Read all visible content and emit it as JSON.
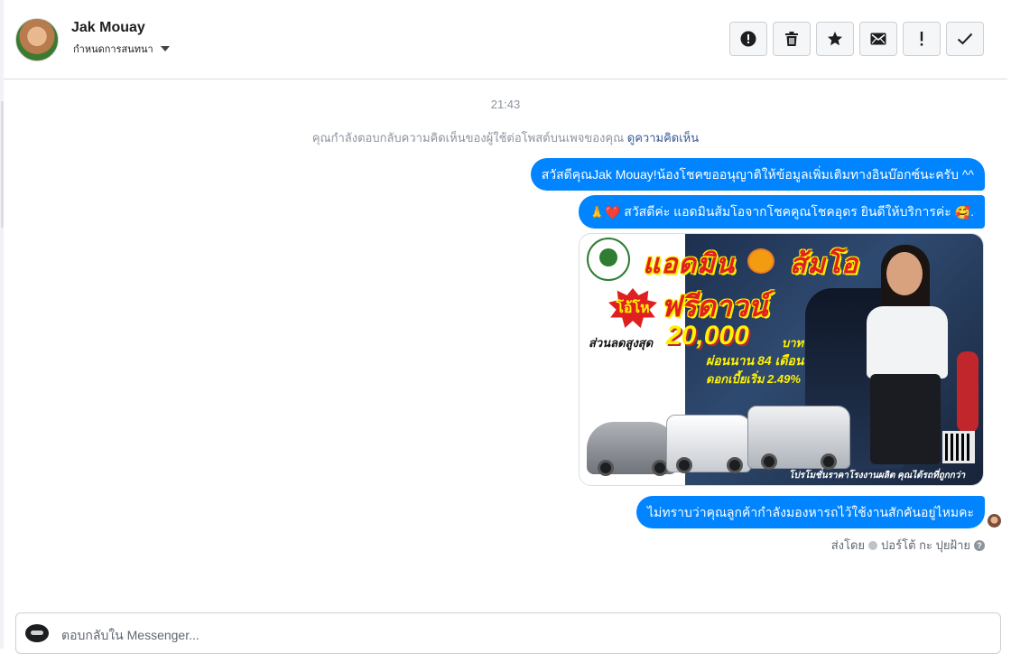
{
  "header": {
    "contact_name": "Jak Mouay",
    "assign_label": "กำหนดการสนทนา",
    "toolbar": [
      {
        "name": "report-spam-button",
        "icon": "alert-circle-icon"
      },
      {
        "name": "delete-button",
        "icon": "trash-icon"
      },
      {
        "name": "star-button",
        "icon": "star-icon"
      },
      {
        "name": "mark-unread-button",
        "icon": "envelope-icon"
      },
      {
        "name": "follow-up-button",
        "icon": "exclamation-icon"
      },
      {
        "name": "mark-done-button",
        "icon": "checkmark-icon"
      }
    ]
  },
  "conversation": {
    "timestamp": "21:43",
    "notice_text": "คุณกำลังตอบกลับความคิดเห็นของผู้ใช้ต่อโพสต์บนเพจของคุณ",
    "notice_link": "ดูความคิดเห็น",
    "messages": [
      {
        "text": "สวัสดีคุณJak Mouay!น้องโชคขออนุญาติให้ข้อมูลเพิ่มเติมทางอินบ๊อกซ์นะครับ ^^"
      },
      {
        "prefix_emoji": "🙏❤️",
        "text": " สวัสดีค่ะ แอดมินส้มโอจากโชคคูณโชคอุดร ยินดีให้บริการค่ะ ",
        "suffix_emoji": "🥰",
        "tail": "."
      },
      {
        "text": "ไม่ทราบว่าคุณลูกค้ากำลังมองหารถไว้ใช้งานสักคันอยู่ไหมคะ"
      }
    ],
    "promo_image": {
      "title": "แอดมิน",
      "title2": "ส้มโอ",
      "burst": "โอ้โห",
      "headline": "ฟรีดาวน์",
      "discount_label": "ส่วนลดสูงสุด",
      "discount_amount": "20,000",
      "currency": "บาท",
      "installment": "ผ่อนนาน 84 เดือน",
      "rate": "ดอกเบี้ยเริ่ม 2.49%",
      "footer": "โปรโมชั่นราคาโรงงานผลิต คุณได้รถที่ถูกกว่า"
    },
    "sent_by": {
      "label": "ส่งโดย",
      "name": "ปอร์โต้ กะ ปุยฝ้าย",
      "help": "?"
    }
  },
  "composer": {
    "placeholder": "ตอบกลับใน Messenger..."
  },
  "colors": {
    "bubble": "#0084ff",
    "link": "#385898",
    "meta_text": "#8d949e"
  }
}
